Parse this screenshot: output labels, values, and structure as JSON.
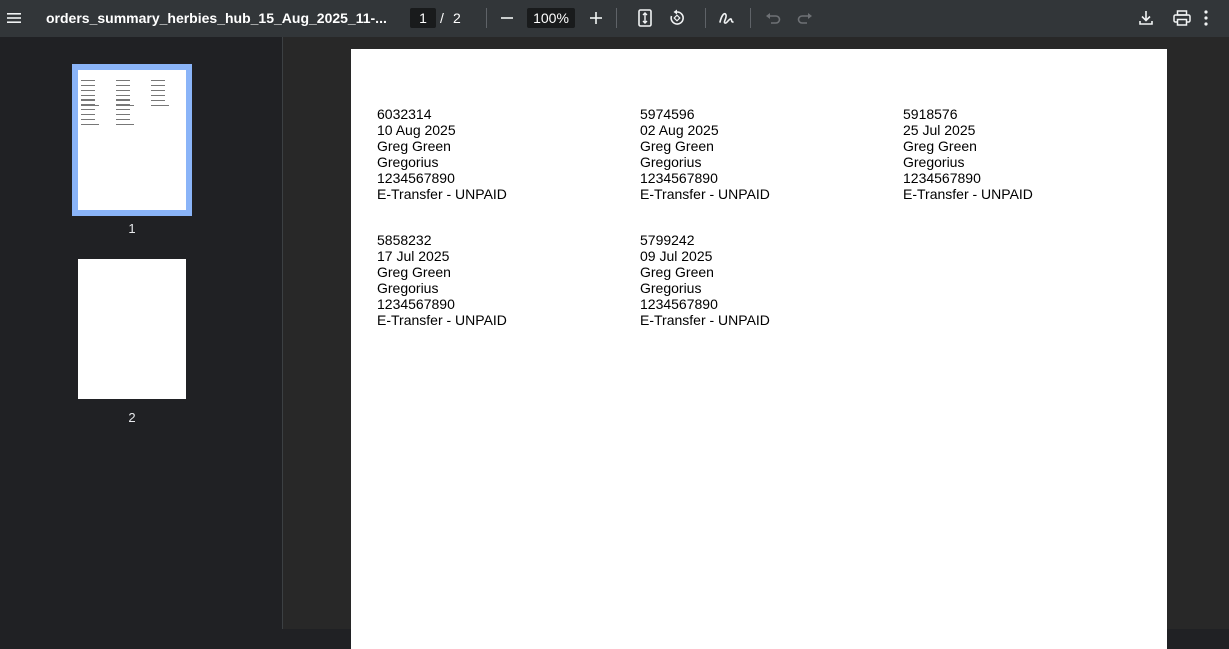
{
  "toolbar": {
    "title": "orders_summary_herbies_hub_15_Aug_2025_11-...",
    "current_page": "1",
    "page_separator": "/",
    "total_pages": "2",
    "zoom": "100%"
  },
  "sidebar": {
    "thumbnails": [
      {
        "label": "1"
      },
      {
        "label": "2"
      }
    ]
  },
  "document": {
    "records": [
      {
        "id": "6032314",
        "date": "10 Aug 2025",
        "name": "Greg Green",
        "company": "Gregorius",
        "phone": "1234567890",
        "payment": "E-Transfer - UNPAID"
      },
      {
        "id": "5974596",
        "date": "02 Aug 2025",
        "name": "Greg Green",
        "company": "Gregorius",
        "phone": "1234567890",
        "payment": "E-Transfer - UNPAID"
      },
      {
        "id": "5918576",
        "date": "25 Jul 2025",
        "name": "Greg Green",
        "company": "Gregorius",
        "phone": "1234567890",
        "payment": "E-Transfer - UNPAID"
      },
      {
        "id": "5858232",
        "date": "17 Jul 2025",
        "name": "Greg Green",
        "company": "Gregorius",
        "phone": "1234567890",
        "payment": "E-Transfer - UNPAID"
      },
      {
        "id": "5799242",
        "date": "09 Jul 2025",
        "name": "Greg Green",
        "company": "Gregorius",
        "phone": "1234567890",
        "payment": "E-Transfer - UNPAID"
      }
    ]
  },
  "colors": {
    "toolbar_bg": "#323639",
    "sidebar_bg": "#202124",
    "viewer_bg": "#282828",
    "selection": "#8ab4f8"
  }
}
